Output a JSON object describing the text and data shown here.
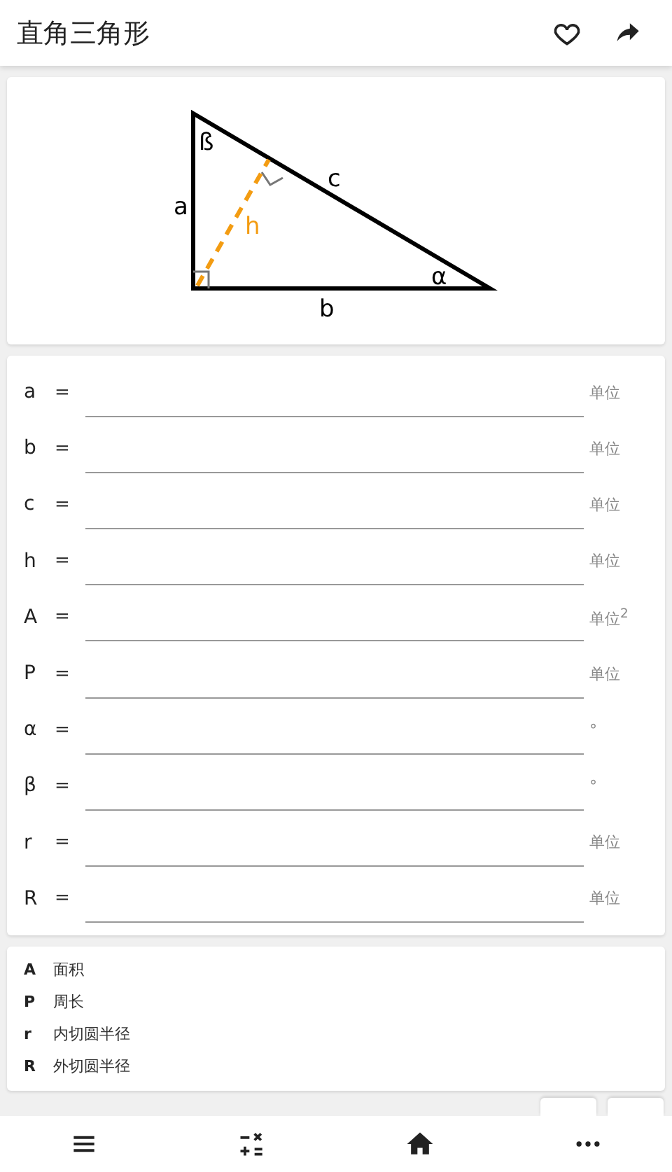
{
  "header": {
    "title": "直角三角形"
  },
  "diagram": {
    "labels": [
      {
        "kind": "vertex_angle",
        "text": "ß"
      },
      {
        "kind": "side_c",
        "text": "c"
      },
      {
        "kind": "side_a",
        "text": "a"
      },
      {
        "kind": "height",
        "text": "h"
      },
      {
        "kind": "base_angle",
        "text": "α"
      },
      {
        "kind": "side_b",
        "text": "b"
      }
    ]
  },
  "fields": [
    {
      "label": "a",
      "unit": "单位"
    },
    {
      "label": "b",
      "unit": "单位"
    },
    {
      "label": "c",
      "unit": "单位"
    },
    {
      "label": "h",
      "unit": "单位"
    },
    {
      "label": "A",
      "unit": "单位$^{2}$"
    },
    {
      "label": "P",
      "unit": "单位"
    },
    {
      "label": "α",
      "unit": "°"
    },
    {
      "label": "β",
      "unit": "°"
    },
    {
      "label": "r",
      "unit": "单位"
    },
    {
      "label": "R",
      "unit": "单位"
    }
  ],
  "legend": [
    {
      "symbol": "A",
      "meaning": "面积"
    },
    {
      "symbol": "P",
      "meaning": "周长"
    },
    {
      "symbol": "r",
      "meaning": "内切圆半径"
    },
    {
      "symbol": "R",
      "meaning": "外切圆半径"
    }
  ],
  "equals": "="
}
